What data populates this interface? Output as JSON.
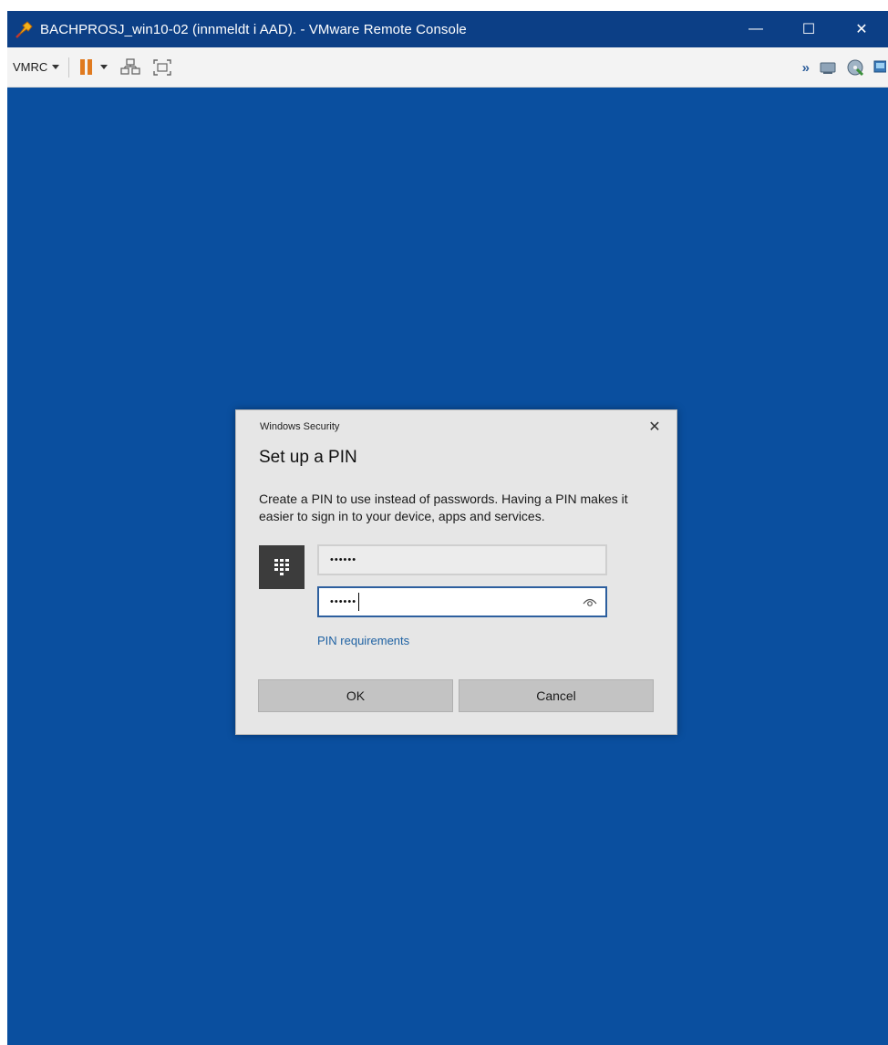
{
  "window": {
    "title": "BACHPROSJ_win10-02 (innmeldt i AAD). - VMware Remote Console",
    "controls": {
      "minimize": "—",
      "maximize": "☐",
      "close": "✕"
    },
    "background_color": "#0a4f9f"
  },
  "toolbar": {
    "menu_label": "VMRC",
    "right_icons": [
      "chevron-double-right-icon",
      "removable-device-icon",
      "cd-drive-icon",
      "network-icon"
    ]
  },
  "dialog": {
    "header": "Windows Security",
    "close": "✕",
    "title": "Set up a PIN",
    "description": "Create a PIN to use instead of passwords. Having a PIN makes it easier to sign in to your device, apps and services.",
    "pin_value": "••••••",
    "confirm_pin_value": "••••••",
    "pin_requirements_link": "PIN requirements",
    "ok_label": "OK",
    "cancel_label": "Cancel",
    "link_color": "#1f62a3"
  }
}
